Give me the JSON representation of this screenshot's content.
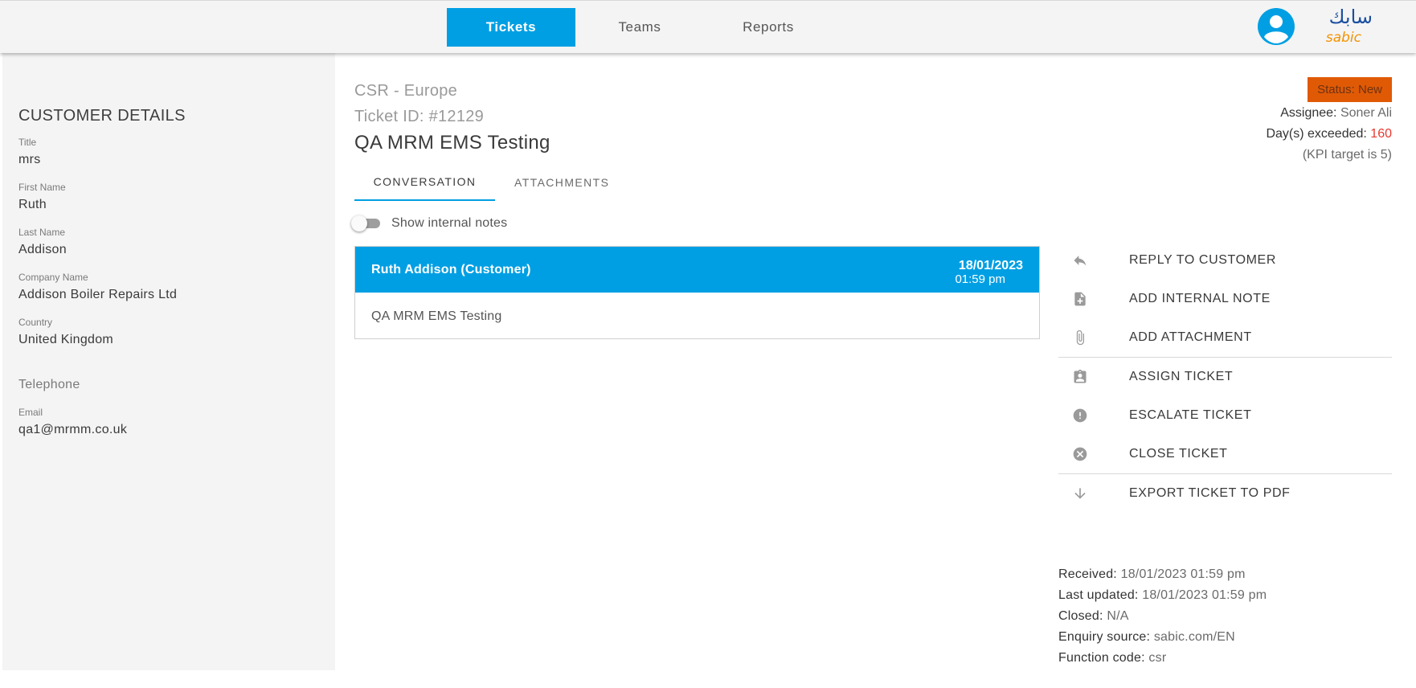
{
  "nav": {
    "tabs": [
      "Tickets",
      "Teams",
      "Reports"
    ],
    "active": "Tickets",
    "brand_arabic": "سابك",
    "brand_latin": "sabic"
  },
  "customer": {
    "heading": "CUSTOMER DETAILS",
    "title_label": "Title",
    "title_value": "mrs",
    "first_name_label": "First Name",
    "first_name_value": "Ruth",
    "last_name_label": "Last Name",
    "last_name_value": "Addison",
    "company_label": "Company Name",
    "company_value": "Addison Boiler Repairs Ltd",
    "country_label": "Country",
    "country_value": "United Kingdom",
    "telephone_heading": "Telephone",
    "email_label": "Email",
    "email_value": "qa1@mrmm.co.uk"
  },
  "ticket": {
    "queue": "CSR - Europe",
    "id_text": "Ticket ID: #12129",
    "subject": "QA MRM EMS Testing",
    "status_label": "Status:",
    "status_value": "New",
    "assignee_label": "Assignee:",
    "assignee_value": "Soner Ali",
    "days_label": "Day(s) exceeded:",
    "days_value": "160",
    "kpi_text": "(KPI target is 5)"
  },
  "tabs": {
    "conversation": "CONVERSATION",
    "attachments": "ATTACHMENTS"
  },
  "toggle": {
    "label": "Show internal notes",
    "on": false
  },
  "message": {
    "author": "Ruth Addison (Customer)",
    "date": "18/01/2023",
    "time": "01:59 pm",
    "body": "QA MRM EMS Testing"
  },
  "actions": {
    "reply": "REPLY TO CUSTOMER",
    "note": "ADD INTERNAL NOTE",
    "attach": "ADD ATTACHMENT",
    "assign": "ASSIGN TICKET",
    "escalate": "ESCALATE TICKET",
    "close": "CLOSE TICKET",
    "export": "EXPORT TICKET TO PDF"
  },
  "info": {
    "received_label": "Received:",
    "received_value": "18/01/2023 01:59 pm",
    "updated_label": "Last updated:",
    "updated_value": "18/01/2023 01:59 pm",
    "closed_label": "Closed:",
    "closed_value": "N/A",
    "source_label": "Enquiry source:",
    "source_value": "sabic.com/EN",
    "function_label": "Function code:",
    "function_value": "csr"
  },
  "colors": {
    "accent": "#009fe3",
    "status": "#e05a06",
    "alert": "#e8382f",
    "logo_orange": "#f39200"
  },
  "icons": [
    "user-avatar-icon",
    "reply-icon",
    "note-add-icon",
    "paperclip-icon",
    "assign-icon",
    "exclamation-icon",
    "close-circle-icon",
    "arrow-down-icon"
  ]
}
